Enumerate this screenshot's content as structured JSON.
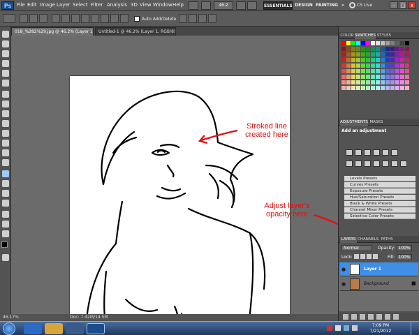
{
  "app": {
    "logo": "Ps",
    "menu": [
      "File",
      "Edit",
      "Image",
      "Layer",
      "Select",
      "Filter",
      "Analysis",
      "3D",
      "View",
      "Window",
      "Help"
    ],
    "zoom_field": "46.2",
    "workspaces": [
      "ESSENTIALS",
      "DESIGN",
      "PAINTING"
    ],
    "more": "»",
    "cs_live": "CS Live",
    "window_controls": {
      "minimize": "–",
      "maximize": "□",
      "close": "x"
    }
  },
  "options": {
    "auto_add_delete": "Auto Add/Delete"
  },
  "tabs": [
    "018_%282%29.jpg @ 46.2% (Layer 1, RGB/8) *",
    "Untitled-1 @ 46.2% (Layer 1, RGB/8)"
  ],
  "annotations": {
    "stroke_note": "Stroked line created here",
    "opacity_note": "Adjust layer's opacity here"
  },
  "status": {
    "zoom": "46.17%",
    "doc": "Doc: 7.42M/14.5M"
  },
  "panels": {
    "color_tabs": [
      "COLOR",
      "SWATCHES",
      "STYLES"
    ],
    "adjust_tabs": [
      "ADJUSTMENTS",
      "MASKS"
    ],
    "add_adjustment": "Add an adjustment",
    "presets": [
      "Levels Presets",
      "Curves Presets",
      "Exposure Presets",
      "Hue/Saturation Presets",
      "Black & White Presets",
      "Channel Mixer Presets",
      "Selective Color Presets"
    ],
    "layer_tabs": [
      "LAYERS",
      "CHANNELS",
      "PATHS"
    ],
    "blend_mode": "Normal",
    "opacity_label": "Opacity:",
    "opacity_value": "100%",
    "lock_label": "Lock:",
    "fill_label": "Fill:",
    "fill_value": "100%",
    "layers": [
      {
        "name": "Layer 1",
        "selected": true
      },
      {
        "name": "Background",
        "selected": false
      }
    ]
  },
  "taskbar": {
    "time": "7:09 PM",
    "date": "7/21/2012"
  },
  "colors": {
    "annotation": "#e01010",
    "selection": "#3f8fe8",
    "swatches": [
      "#ff0000",
      "#ffff00",
      "#00ff00",
      "#00ffff",
      "#0000ff",
      "#ff00ff",
      "#ffffff",
      "#e0e0e0",
      "#c0c0c0",
      "#a0a0a0",
      "#808080",
      "#606060",
      "#404040",
      "#000000",
      "#ff8080",
      "#ffc080"
    ]
  }
}
